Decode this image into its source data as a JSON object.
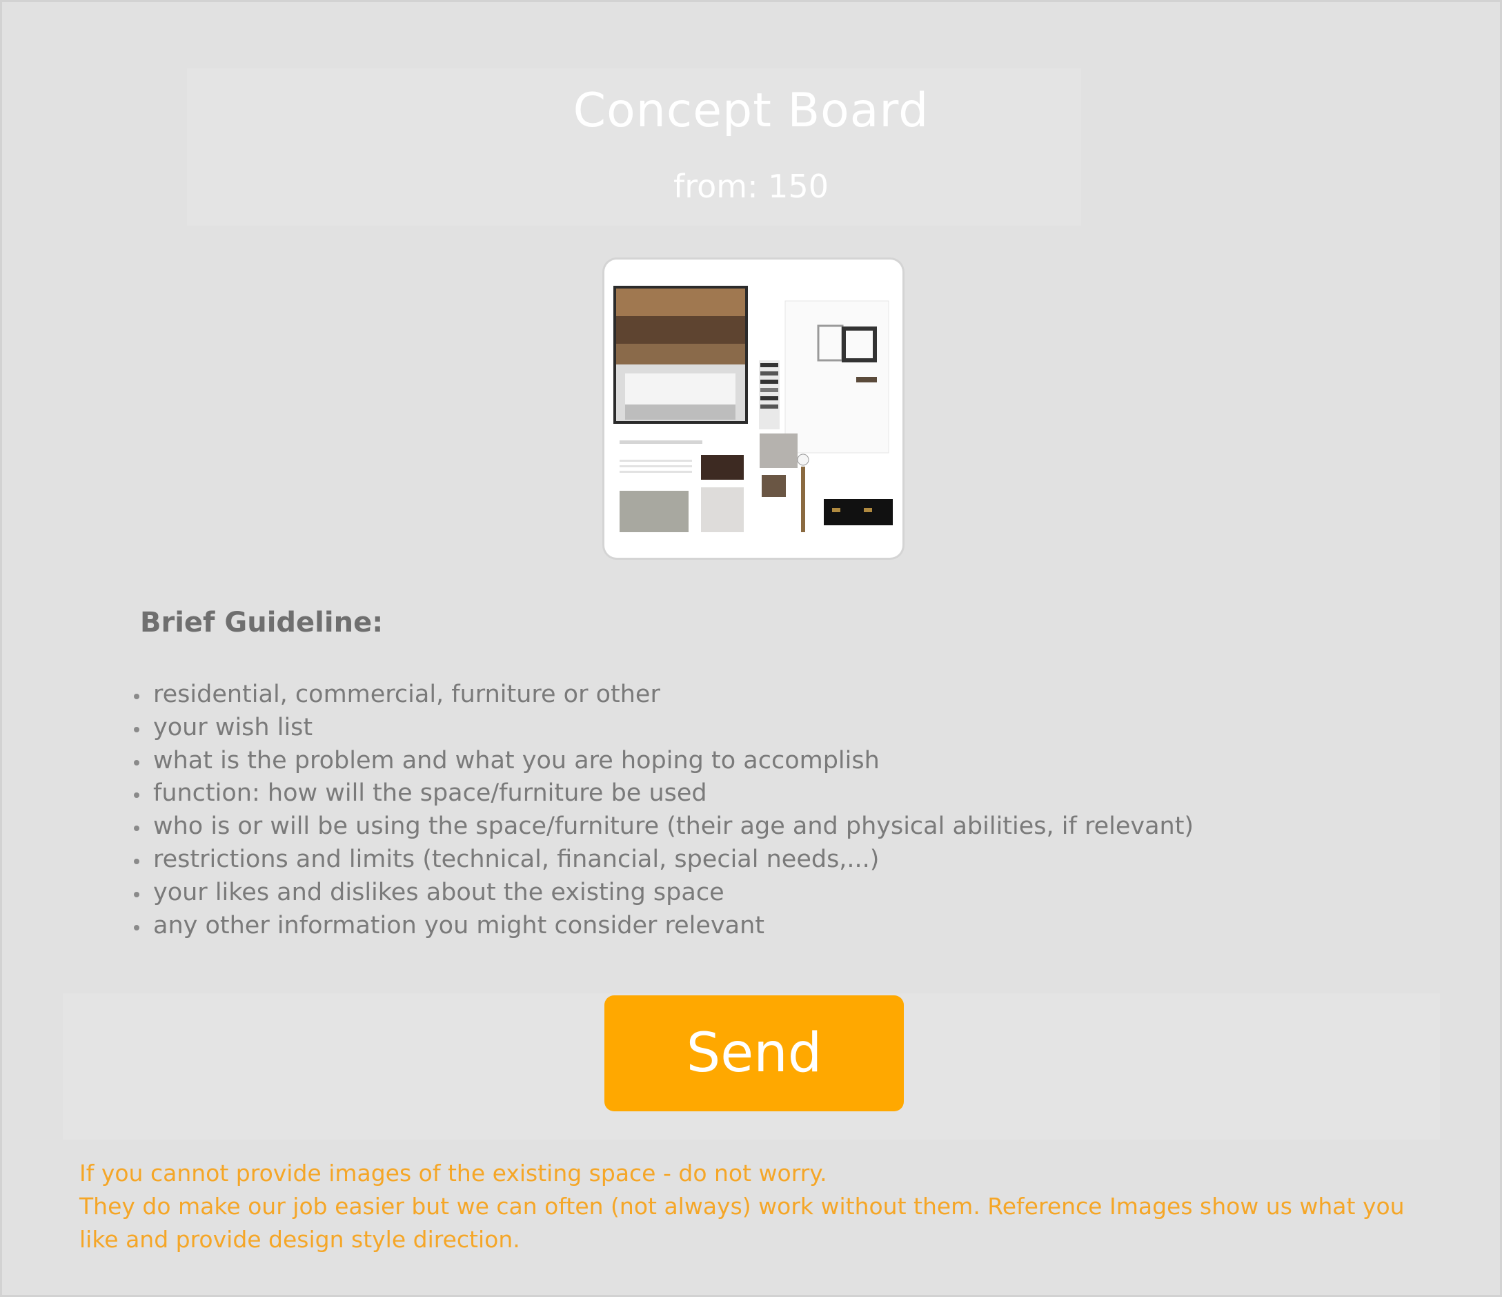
{
  "header": {
    "title": "Concept Board",
    "price": "from: 150"
  },
  "image": {
    "icon": "concept-board-moodboard-image"
  },
  "guideline": {
    "heading": "Brief Guideline:",
    "items": [
      "residential, commercial, furniture or other",
      "your wish list",
      "what is the problem and what you are hoping to accomplish",
      "function: how will the space/furniture be used",
      "who is or will be using the space/furniture (their age and physical abilities, if relevant)",
      "restrictions and limits (technical, financial, special needs,...)",
      "your likes and dislikes about the existing space",
      "any other information you might consider relevant"
    ]
  },
  "actions": {
    "send_label": "Send"
  },
  "note": {
    "line1": "If you cannot provide images of the existing space - do not worry.",
    "line2": "They do make our job easier but we can often (not always) work without them. Reference Images show us what you",
    "line3": "like and provide design style direction."
  },
  "colors": {
    "accent": "#ffa800",
    "note_text": "#f5a627",
    "background": "#e1e1e1"
  }
}
